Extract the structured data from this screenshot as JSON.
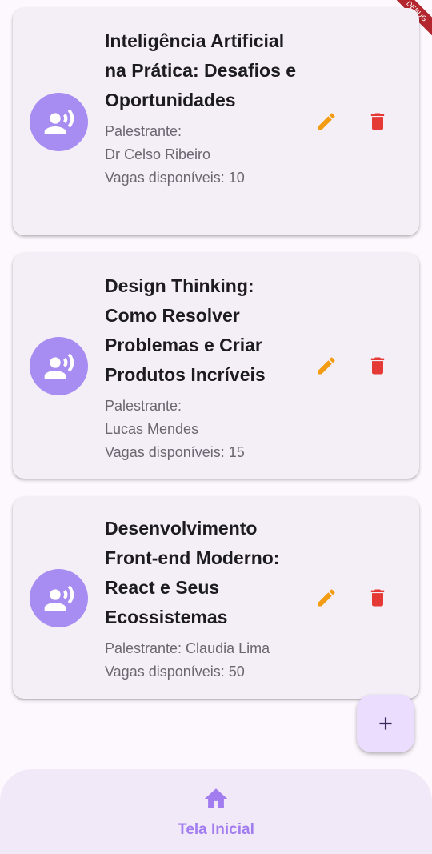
{
  "debug_banner": "DEBUG",
  "events": [
    {
      "title": "Inteligência Artificial na Prática: Desafios e Oportunidades",
      "speaker_line": "Palestrante:",
      "speaker_name": "Dr Celso Ribeiro",
      "slots_line": "Vagas disponíveis: 10"
    },
    {
      "title": "Design Thinking: Como Resolver Problemas e Criar Produtos Incríveis",
      "speaker_line": "Palestrante:",
      "speaker_name": "Lucas Mendes",
      "slots_line": "Vagas disponíveis: 15"
    },
    {
      "title": "Desenvolvimento Front-end Moderno: React e Seus Ecossistemas",
      "speaker_line": "Palestrante: Claudia Lima",
      "slots_line": "Vagas disponíveis: 50"
    }
  ],
  "icons": {
    "avatar": "record-voice-over-icon",
    "edit": "pencil-icon",
    "delete": "trash-icon",
    "fab": "plus-icon",
    "nav": "home-icon"
  },
  "colors": {
    "avatar_bg": "#a78cf2",
    "edit": "#f39c12",
    "delete": "#e53935",
    "accent": "#a27df0",
    "fab_bg": "#ebddfe"
  },
  "bottom_nav": {
    "items": [
      {
        "label": "Tela Inicial",
        "active": true
      }
    ]
  }
}
